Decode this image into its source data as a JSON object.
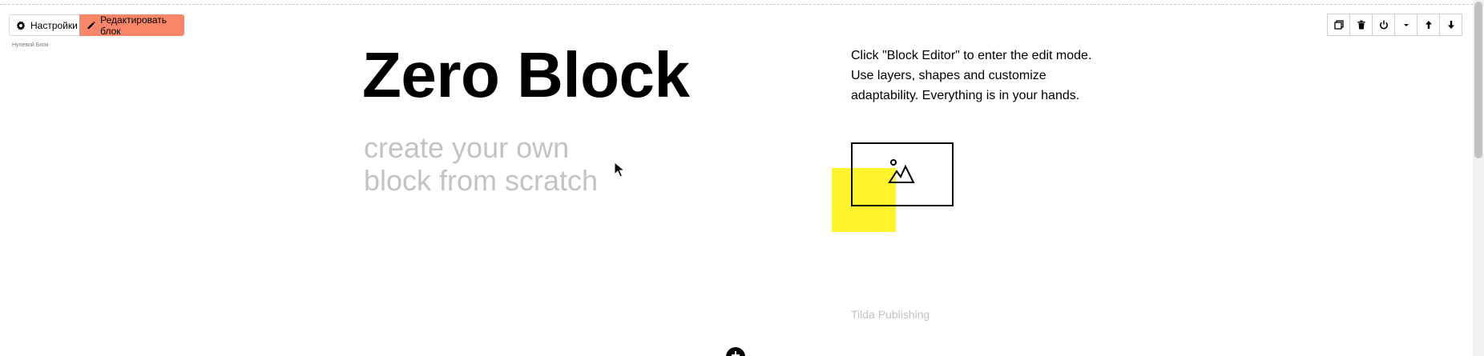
{
  "toolbar_left": {
    "settings_label": "Настройки",
    "settings_icon": "gear-icon",
    "edit_label": "Редактировать блок",
    "edit_icon": "pencil-icon",
    "edit_color": "#fa8669"
  },
  "block_caption": "Нулевой Блок",
  "toolbar_right": {
    "icons": [
      "duplicate-icon",
      "trash-icon",
      "power-icon",
      "caret-down-icon",
      "arrow-up-icon",
      "arrow-down-icon"
    ]
  },
  "content": {
    "title": "Zero Block",
    "subtitle": "create your own block from scratch",
    "description": "Click \"Block Editor\" to enter the edit mode. Use layers, shapes and customize adaptability. Everything is in your hands.",
    "footer_text": "Tilda Publishing",
    "accent_color": "#fff42b"
  }
}
